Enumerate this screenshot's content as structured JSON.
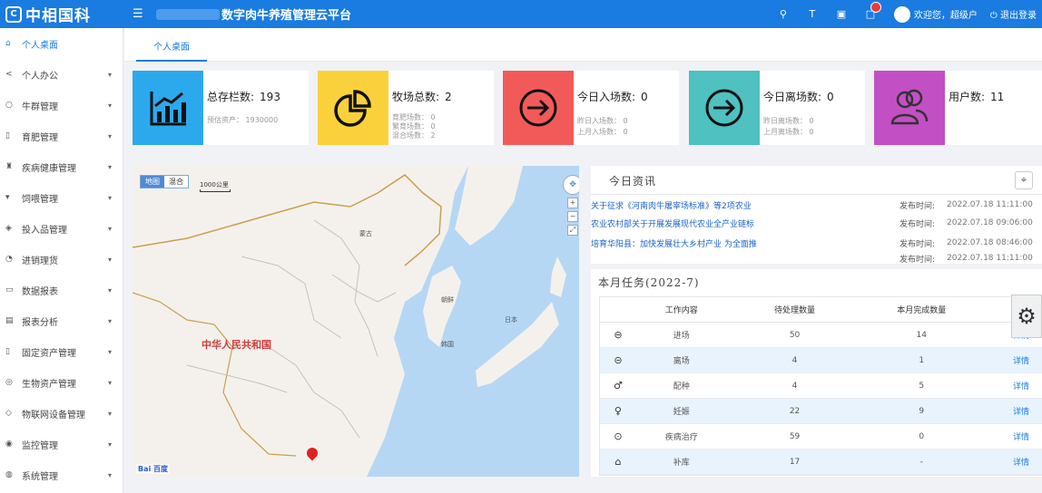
{
  "header": {
    "logo_mark": "C",
    "logo_text": "中相国科",
    "app_title": "数字肉牛养殖管理云平台",
    "welcome": "欢迎您，超级户",
    "logout": "退出登录",
    "notification_count": "",
    "icons": [
      "search-icon",
      "font-size-icon",
      "document-icon",
      "bell-icon",
      "user-icon",
      "power-icon"
    ]
  },
  "sidebar": {
    "items": [
      {
        "label": "个人桌面",
        "icon": "home-icon",
        "active": true
      },
      {
        "label": "个人办公",
        "icon": "share-icon"
      },
      {
        "label": "牛群管理",
        "icon": "cow-icon"
      },
      {
        "label": "育肥管理",
        "icon": "calendar-icon"
      },
      {
        "label": "疾病健康管理",
        "icon": "medical-icon"
      },
      {
        "label": "饲喂管理",
        "icon": "feed-icon"
      },
      {
        "label": "投入品管理",
        "icon": "box-icon"
      },
      {
        "label": "进销理货",
        "icon": "cart-icon"
      },
      {
        "label": "数据报表",
        "icon": "report-icon"
      },
      {
        "label": "报表分析",
        "icon": "chart-icon"
      },
      {
        "label": "固定资产管理",
        "icon": "asset-icon"
      },
      {
        "label": "生物资产管理",
        "icon": "bio-asset-icon"
      },
      {
        "label": "物联网设备管理",
        "icon": "iot-icon"
      },
      {
        "label": "监控管理",
        "icon": "camera-icon"
      },
      {
        "label": "系统管理",
        "icon": "settings-icon"
      }
    ]
  },
  "tabs": [
    {
      "label": "个人桌面"
    }
  ],
  "cards": [
    {
      "title": "总存栏数:",
      "value": "193",
      "color": "#2ca9ec",
      "icon": "bar-chart-icon",
      "subs": [
        "预估资产： 1930000"
      ]
    },
    {
      "title": "牧场总数:",
      "value": "2",
      "color": "#fbd13b",
      "icon": "pie-chart-icon",
      "subs": [
        "育肥场数： 0",
        "繁育场数： 0",
        "混合场数： 2"
      ]
    },
    {
      "title": "今日入场数:",
      "value": "0",
      "color": "#f25a5a",
      "icon": "arrow-in-icon",
      "subs": [
        "昨日入场数： 0",
        "上月入场数： 0"
      ]
    },
    {
      "title": "今日离场数:",
      "value": "0",
      "color": "#4ec1c0",
      "icon": "arrow-out-icon",
      "subs": [
        "昨日离场数： 0",
        "上月离场数： 0"
      ]
    },
    {
      "title": "用户数:",
      "value": "11",
      "color": "#c34fc5",
      "icon": "users-icon",
      "subs": []
    }
  ],
  "map": {
    "toggle": [
      "地图",
      "混合"
    ],
    "scale": "1000公里",
    "country_label": "中华人民共和国",
    "labels": [
      "蒙古",
      "朝鲜",
      "韩国",
      "日本"
    ],
    "logo": "Bai 百度"
  },
  "news": {
    "title": "今日资讯",
    "publish_label": "发布时间:",
    "items": [
      {
        "text": "关于征求《河南肉牛屠宰场标准》等2项农业",
        "date": "2022.07.18 11:11:00"
      },
      {
        "text": "农业农村部关于开展发展现代农业全产业链标",
        "date": "2022.07.18 09:06:00"
      },
      {
        "text": "培育华阳县：加快发展壮大乡村产业 为全面推",
        "date": "2022.07.18 08:46:00"
      },
      {
        "text": "",
        "date": "2022.07.18 11:11:00"
      }
    ]
  },
  "tasks": {
    "title": "本月任务(2022-7)",
    "headers": [
      "工作内容",
      "待处理数量",
      "本月完成数量",
      "操作"
    ],
    "rows": [
      {
        "icon": "enter-icon",
        "name": "进场",
        "pending": "50",
        "done": "14",
        "op": "详情"
      },
      {
        "icon": "exit-icon",
        "name": "离场",
        "pending": "4",
        "done": "1",
        "op": "详情"
      },
      {
        "icon": "male-icon",
        "name": "配种",
        "pending": "4",
        "done": "5",
        "op": "详情"
      },
      {
        "icon": "female-icon",
        "name": "妊娠",
        "pending": "22",
        "done": "9",
        "op": "详情"
      },
      {
        "icon": "check-icon",
        "name": "疾病治疗",
        "pending": "59",
        "done": "0",
        "op": "详情"
      },
      {
        "icon": "barn-icon",
        "name": "补库",
        "pending": "17",
        "done": "-",
        "op": "详情"
      }
    ]
  }
}
